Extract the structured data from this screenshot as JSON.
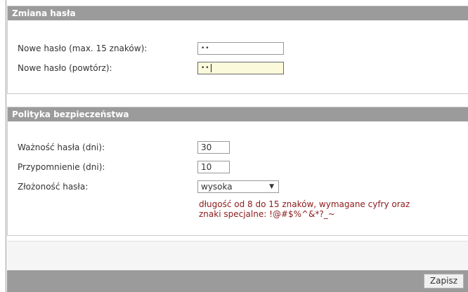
{
  "password_panel": {
    "title": "Zmiana hasła",
    "new_password_label": "Nowe hasło (max. 15 znaków):",
    "new_password_value": "••",
    "repeat_password_label": "Nowe hasło (powtórz):",
    "repeat_password_value": "••"
  },
  "policy_panel": {
    "title": "Polityka bezpieczeństwa",
    "validity_label": "Ważność hasła (dni):",
    "validity_value": "30",
    "reminder_label": "Przypomnienie (dni):",
    "reminder_value": "10",
    "complexity_label": "Złożoność hasła:",
    "complexity_value": "wysoka",
    "complexity_hint": "długość od 8 do 15 znaków, wymagane cyfry oraz znaki specjalne: !@#$%^&*?_~"
  },
  "footer": {
    "save_label": "Zapisz"
  },
  "colors": {
    "header_bg": "#9b9b9b",
    "hint_text": "#8b1a1a",
    "focused_input_bg": "#fbfbdc"
  }
}
